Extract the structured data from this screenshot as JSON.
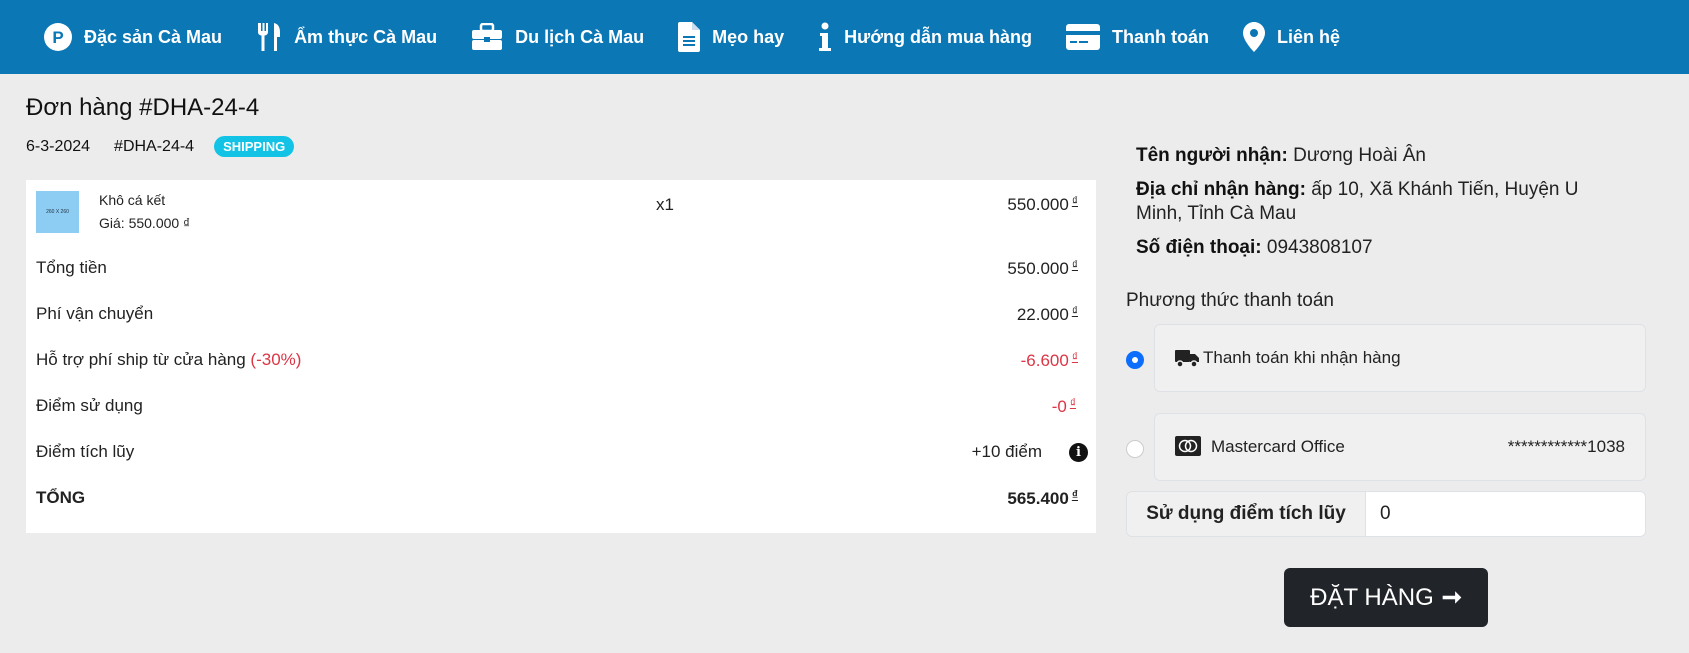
{
  "nav": {
    "items": [
      {
        "label": "Đặc sản Cà Mau",
        "icon": "parking-circle-icon"
      },
      {
        "label": "Ẩm thực Cà Mau",
        "icon": "utensils-icon"
      },
      {
        "label": "Du lịch Cà Mau",
        "icon": "briefcase-icon"
      },
      {
        "label": "Mẹo hay",
        "icon": "document-icon"
      },
      {
        "label": "Hướng dẫn mua hàng",
        "icon": "info-icon"
      },
      {
        "label": "Thanh toán",
        "icon": "credit-card-icon"
      },
      {
        "label": "Liên hệ",
        "icon": "map-marker-icon"
      }
    ]
  },
  "order": {
    "title": "Đơn hàng #DHA-24-4",
    "date": "6-3-2024",
    "code": "#DHA-24-4",
    "status": "SHIPPING"
  },
  "item": {
    "thumb_text": "260 X 260",
    "name": "Khô cá kết",
    "price": "Giá: 550.000 ₫",
    "qty": "x1",
    "total": "550.000",
    "currency": "₫"
  },
  "summary": {
    "subtotal_label": "Tổng tiền",
    "subtotal": "550.000",
    "shipping_label": "Phí vận chuyển",
    "shipping": "22.000",
    "discount_label": "Hỗ trợ phí ship từ cửa hàng",
    "discount_pct": "(-30%)",
    "discount": "-6.600",
    "points_used_label": "Điểm sử dụng",
    "points_used": "-0",
    "points_earned_label": "Điểm tích lũy",
    "points_earned": "+10 điểm",
    "total_label": "TỔNG",
    "total": "565.400",
    "currency": "₫"
  },
  "receiver": {
    "name_label": "Tên người nhận:",
    "name": "Dương Hoài Ân",
    "address_label": "Địa chỉ nhận hàng:",
    "address": "ấp 10, Xã Khánh Tiến, Huyện U Minh, Tỉnh Cà Mau",
    "phone_label": "Số điện thoại:",
    "phone": "0943808107"
  },
  "payment": {
    "title": "Phương thức thanh toán",
    "cod_label": "Thanh toán khi nhận hàng",
    "card_label": "Mastercard Office",
    "card_number": "************1038",
    "selected": "cod"
  },
  "points_input": {
    "label": "Sử dụng điểm tích lũy",
    "value": "0"
  },
  "order_button": {
    "label": "ĐẶT HÀNG",
    "arrow": "➞"
  },
  "colors": {
    "nav_bg": "#0b77b5",
    "badge": "#12c3e6",
    "danger": "#dc3545",
    "primary": "#0d6efd",
    "button": "#212529"
  }
}
